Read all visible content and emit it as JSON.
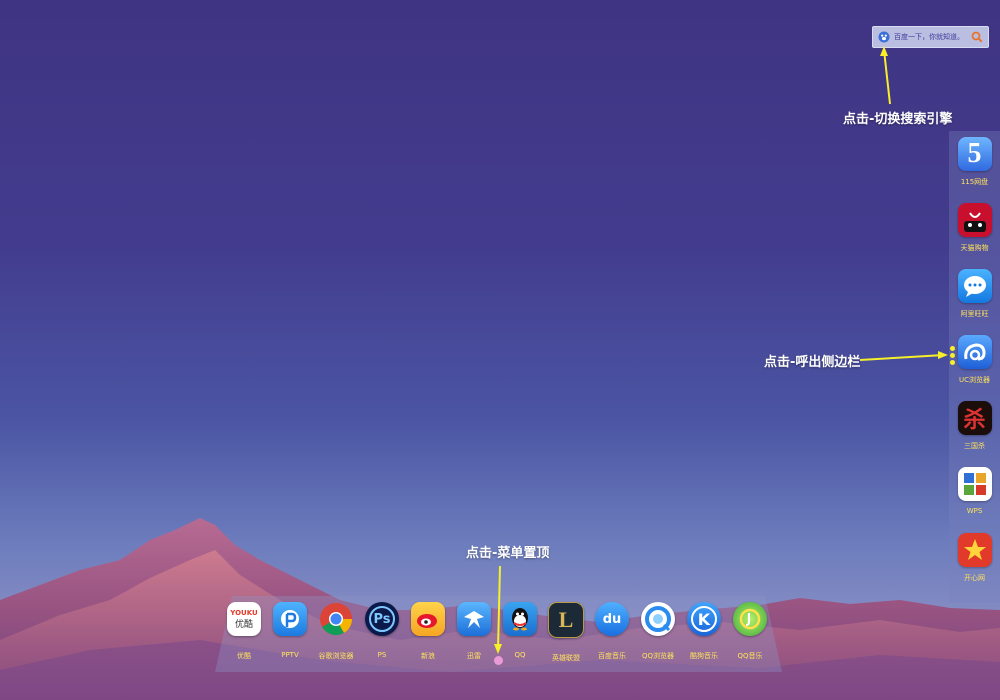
{
  "search": {
    "placeholder": "百度一下，你就知道。",
    "engine_icon": "baidu-paw-icon",
    "button_icon": "search-icon",
    "accent": "#e8742a"
  },
  "annotations": {
    "search": "点击-切换搜索引擎",
    "sidebar": "点击-呼出侧边栏",
    "dock": "点击-菜单置顶"
  },
  "sidebar": {
    "items": [
      {
        "label": "115网盘",
        "icon": "115-icon"
      },
      {
        "label": "天猫购物",
        "icon": "tmall-icon"
      },
      {
        "label": "阿里旺旺",
        "icon": "wangwang-icon"
      },
      {
        "label": "UC浏览器",
        "icon": "uc-browser-icon"
      },
      {
        "label": "三国杀",
        "icon": "sanguosha-icon"
      },
      {
        "label": "WPS",
        "icon": "wps-icon"
      },
      {
        "label": "开心网",
        "icon": "kaixin-icon"
      }
    ]
  },
  "dock": {
    "items": [
      {
        "label": "优酷",
        "icon": "youku-icon",
        "text": "YOUKU",
        "text2": "优酷"
      },
      {
        "label": "PPTV",
        "icon": "pptv-icon"
      },
      {
        "label": "谷歌浏览器",
        "icon": "chrome-icon"
      },
      {
        "label": "PS",
        "icon": "photoshop-icon",
        "text": "Ps"
      },
      {
        "label": "新浪",
        "icon": "weibo-icon"
      },
      {
        "label": "迅雷",
        "icon": "xunlei-icon"
      },
      {
        "label": "QQ",
        "icon": "qq-icon"
      },
      {
        "label": "英雄联盟",
        "icon": "lol-icon",
        "text": "L"
      },
      {
        "label": "百度音乐",
        "icon": "baidu-music-icon",
        "text": "du"
      },
      {
        "label": "QQ浏览器",
        "icon": "qq-browser-icon"
      },
      {
        "label": "酷狗音乐",
        "icon": "kugou-icon",
        "text": "K"
      },
      {
        "label": "QQ音乐",
        "icon": "qq-music-icon"
      }
    ]
  },
  "colors": {
    "label": "#ffe25c",
    "arrow": "#f6ef2a",
    "sky_top": "#3f3483",
    "sky_bottom": "#8a8fc4"
  }
}
